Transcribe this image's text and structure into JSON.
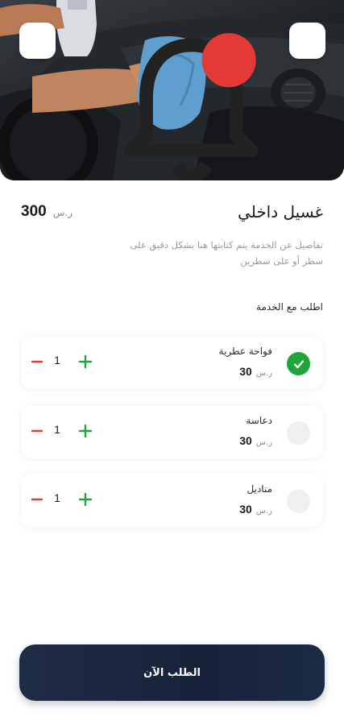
{
  "header": {
    "hero_image": "car-interior-cleaning-photo",
    "notification_icon": "bell-icon",
    "menu_icon": "menu-icon",
    "notification_dot_color": "#e53935"
  },
  "service": {
    "title": "غسيل داخلي",
    "price": "300",
    "currency": "ر.س",
    "description_line1": "تفاصيل عن الخدمة يتم كتابتها هنا بشكل دقيق على",
    "description_line2": "سطر أو على سطرين"
  },
  "addons_section": {
    "label": "اطلب مع الخدمة"
  },
  "addons": [
    {
      "name": "فواحة عطرية",
      "price": "30",
      "currency": "ر.س",
      "quantity": "1",
      "checked": true
    },
    {
      "name": "دعاسة",
      "price": "30",
      "currency": "ر.س",
      "quantity": "1",
      "checked": false
    },
    {
      "name": "مناديل",
      "price": "30",
      "currency": "ر.س",
      "quantity": "1",
      "checked": false
    }
  ],
  "footer": {
    "order_button_label": "الطلب الآن"
  },
  "colors": {
    "accent_green": "#1ea63a",
    "minus_red": "#e53935",
    "button_navy": "#1f2c45"
  }
}
